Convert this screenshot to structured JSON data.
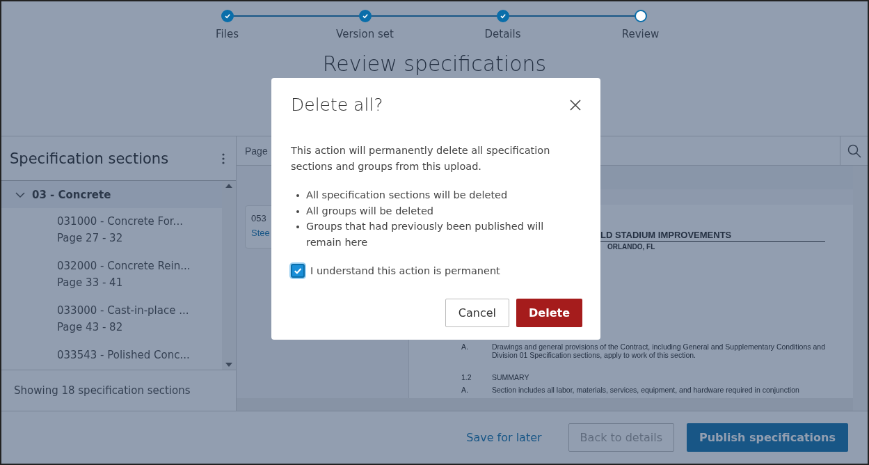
{
  "stepper": {
    "steps": [
      {
        "label": "Files",
        "done": true
      },
      {
        "label": "Version set",
        "done": true
      },
      {
        "label": "Details",
        "done": true
      },
      {
        "label": "Review",
        "done": false
      }
    ]
  },
  "page_title": "Review specifications",
  "sidebar": {
    "title": "Specification sections",
    "groups": [
      {
        "label": "03 - Concrete",
        "expanded": true,
        "children": [
          {
            "title": "031000 - Concrete For...",
            "pages": "Page 27 - 32"
          },
          {
            "title": "032000 - Concrete Rein...",
            "pages": "Page 33 - 41"
          },
          {
            "title": "033000 - Cast-in-place ...",
            "pages": "Page 43 - 82"
          },
          {
            "title": "033543 - Polished Conc..."
          }
        ]
      }
    ],
    "footer": "Showing 18 specification sections"
  },
  "viewer": {
    "page_field": "Page",
    "card": {
      "line_1": "053",
      "line_2": "Stee"
    },
    "document": {
      "heading": "LD STADIUM IMPROVEMENTS",
      "subheading": "ORLANDO, FL",
      "paragraphs": [
        {
          "number": "A.",
          "text": "Drawings and general provisions of the Contract, including General and Supplementary Conditions and Division 01 Specification sections, apply to work of this section."
        },
        {
          "number": "1.2",
          "text": "SUMMARY"
        },
        {
          "number": "A.",
          "text": "Section includes all labor, materials, services, equipment, and hardware required in conjunction"
        }
      ]
    }
  },
  "footer": {
    "save": "Save for later",
    "back": {
      "label": "Back to details",
      "disabled": true
    },
    "publish": "Publish specifications"
  },
  "dialog": {
    "title": "Delete all?",
    "message": "This action will permanently delete all specification sections and groups from this upload.",
    "bullets": [
      "All specification sections will be deleted",
      "All groups will be deleted",
      "Groups that had previously been published will remain here"
    ],
    "confirm": {
      "label": "I understand this action is permanent",
      "checked": true
    },
    "buttons": {
      "cancel": "Cancel",
      "delete": "Delete"
    }
  }
}
